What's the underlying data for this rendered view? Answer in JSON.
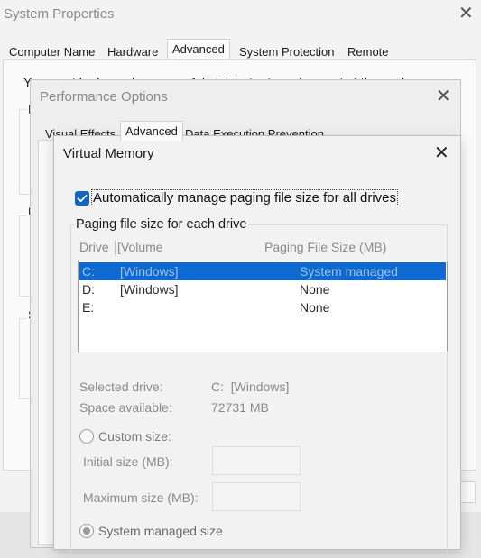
{
  "system_properties": {
    "title": "System Properties",
    "tabs": [
      {
        "label": "Computer Name"
      },
      {
        "label": "Hardware"
      },
      {
        "label": "Advanced"
      },
      {
        "label": "System Protection"
      },
      {
        "label": "Remote"
      }
    ],
    "active_tab": "Advanced",
    "hint_text": "You must be logged on as an Administrator to make most of these changes.",
    "group_initials": [
      "P",
      "U",
      "S"
    ]
  },
  "performance_options": {
    "title": "Performance Options",
    "tabs": [
      {
        "label": "Visual Effects"
      },
      {
        "label": "Advanced"
      },
      {
        "label": "Data Execution Prevention"
      }
    ],
    "active_tab": "Advanced"
  },
  "virtual_memory": {
    "title": "Virtual Memory",
    "auto_manage": {
      "label": "Automatically manage paging file size for all drives",
      "checked": true
    },
    "group_label": "Paging file size for each drive",
    "columns": {
      "drive": "Drive",
      "volume": "[Volume",
      "size": "Paging File Size (MB)"
    },
    "drives": [
      {
        "drive": "C:",
        "volume": "[Windows]",
        "size": "System managed",
        "selected": true
      },
      {
        "drive": "D:",
        "volume": "[Windows]",
        "size": "None",
        "selected": false
      },
      {
        "drive": "E:",
        "volume": "",
        "size": "None",
        "selected": false
      }
    ],
    "selected_drive_label": "Selected drive:",
    "selected_drive_value": "C:  [Windows]",
    "space_available_label": "Space available:",
    "space_available_value": "72731 MB",
    "custom_size_label": "Custom size:",
    "initial_size_label": "Initial size (MB):",
    "maximum_size_label": "Maximum size (MB):",
    "system_managed_label": "System managed size",
    "selected_option": "system_managed"
  },
  "colors": {
    "selection": "#0e6ad1",
    "checkbox": "#1565c0",
    "disabled_text": "#8a8a8a"
  }
}
